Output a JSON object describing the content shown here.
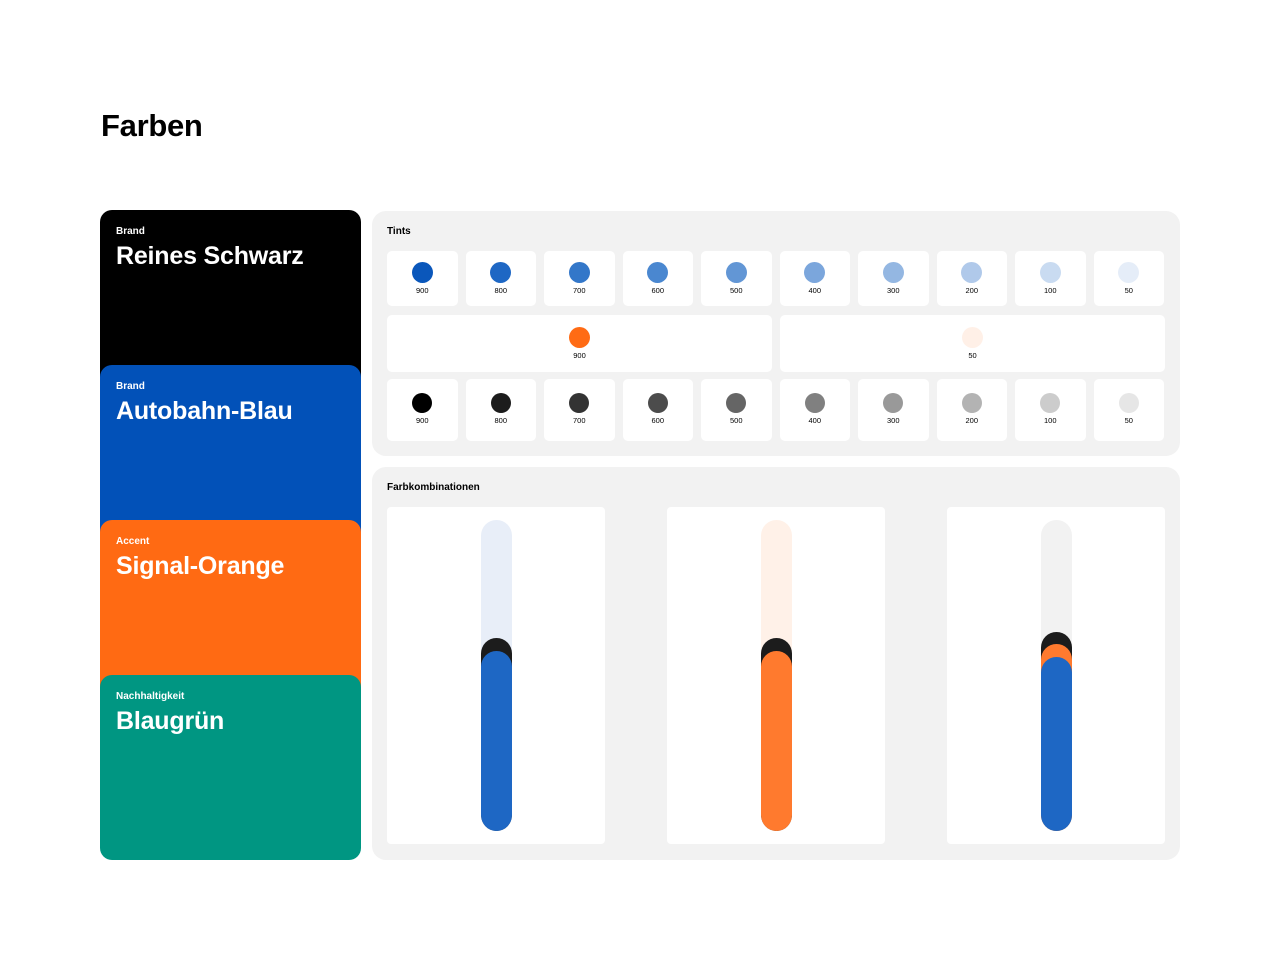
{
  "page": {
    "title": "Farben"
  },
  "brand_colors": [
    {
      "category": "Brand",
      "name": "Reines Schwarz",
      "color": "#000000",
      "text_color": "#ffffff"
    },
    {
      "category": "Brand",
      "name": "Autobahn-Blau",
      "color": "#0251b8",
      "text_color": "#ffffff"
    },
    {
      "category": "Accent",
      "name": "Signal-Orange",
      "color": "#ff6a13",
      "text_color": "#ffffff"
    },
    {
      "category": "Nachhaltigkeit",
      "name": "Blaugrün",
      "color": "#009682",
      "text_color": "#ffffff"
    }
  ],
  "tints": {
    "title": "Tints",
    "blue": [
      {
        "label": "900",
        "color": "#0a57bb"
      },
      {
        "label": "800",
        "color": "#1e67c4"
      },
      {
        "label": "700",
        "color": "#3377c9"
      },
      {
        "label": "600",
        "color": "#4a87d0"
      },
      {
        "label": "500",
        "color": "#6296d5"
      },
      {
        "label": "400",
        "color": "#7ba6dc"
      },
      {
        "label": "300",
        "color": "#94b7e2"
      },
      {
        "label": "200",
        "color": "#b0c9ea"
      },
      {
        "label": "100",
        "color": "#c9dbf1"
      },
      {
        "label": "50",
        "color": "#e5edf8"
      }
    ],
    "orange": [
      {
        "label": "900",
        "color": "#ff6b14"
      },
      {
        "label": "50",
        "color": "#fff0e7"
      }
    ],
    "gray": [
      {
        "label": "900",
        "color": "#000000"
      },
      {
        "label": "800",
        "color": "#1c1c1c"
      },
      {
        "label": "700",
        "color": "#333333"
      },
      {
        "label": "600",
        "color": "#4c4c4c"
      },
      {
        "label": "500",
        "color": "#656565"
      },
      {
        "label": "400",
        "color": "#808080"
      },
      {
        "label": "300",
        "color": "#999999"
      },
      {
        "label": "200",
        "color": "#b3b3b3"
      },
      {
        "label": "100",
        "color": "#cccccc"
      },
      {
        "label": "50",
        "color": "#e6e6e6"
      }
    ]
  },
  "combinations": {
    "title": "Farbkombinationen",
    "items": [
      {
        "track": "#e8eef8",
        "segments": [
          {
            "color": "#1c1c1c",
            "start": 0.38
          },
          {
            "color": "#1e67c4",
            "start": 0.42
          }
        ]
      },
      {
        "track": "#fff1e8",
        "segments": [
          {
            "color": "#1c1c1c",
            "start": 0.38
          },
          {
            "color": "#ff7a2e",
            "start": 0.42
          }
        ]
      },
      {
        "track": "#f2f2f2",
        "segments": [
          {
            "color": "#1c1c1c",
            "start": 0.36
          },
          {
            "color": "#ff7a2e",
            "start": 0.4
          },
          {
            "color": "#1e67c4",
            "start": 0.44
          }
        ]
      }
    ]
  }
}
